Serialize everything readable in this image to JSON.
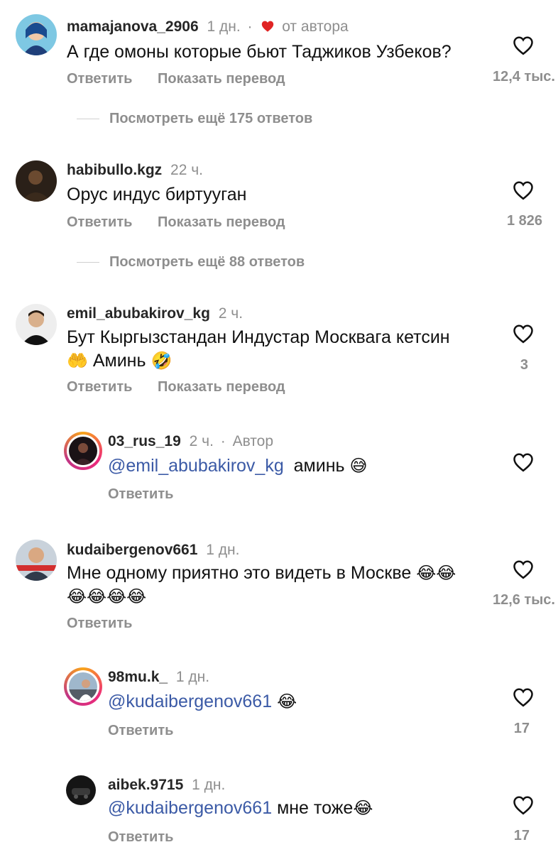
{
  "comments": [
    {
      "username": "mamajanova_2906",
      "time": "1 дн.",
      "author_like_label": "от автора",
      "text": "А где омоны которые бьют Таджиков Узбеков?",
      "reply": "Ответить",
      "translate": "Показать перевод",
      "likes": "12,4 тыс.",
      "view_more": "Посмотреть ещё 175 ответов"
    },
    {
      "username": "habibullo.kgz",
      "time": "22 ч.",
      "text": "Орус индус биртууган",
      "reply": "Ответить",
      "translate": "Показать перевод",
      "likes": "1 826",
      "view_more": "Посмотреть ещё 88 ответов"
    },
    {
      "username": "emil_abubakirov_kg",
      "time": "2 ч.",
      "text_line1": "Бут Кыргызстандан Индустар Москвага кетсин",
      "text_line2": "Аминь",
      "reply": "Ответить",
      "translate": "Показать перевод",
      "likes": "3"
    },
    {
      "username": "03_rus_19",
      "time": "2 ч.",
      "author_label": "Автор",
      "mention": "@emil_abubakirov_kg",
      "text": "аминь",
      "reply": "Ответить"
    },
    {
      "username": "kudaibergenov661",
      "time": "1 дн.",
      "text_line1": "Мне одному приятно это видеть в Москве",
      "reply": "Ответить",
      "likes": "12,6 тыс."
    },
    {
      "username": "98mu.k_",
      "time": "1 дн.",
      "mention": "@kudaibergenov661",
      "reply": "Ответить",
      "likes": "17"
    },
    {
      "username": "aibek.9715",
      "time": "1 дн.",
      "mention": "@kudaibergenov661",
      "text": "мне тоже",
      "reply": "Ответить",
      "likes": "17"
    }
  ],
  "icons": {
    "like": "heart-outline-icon",
    "author_like": "heart-filled-icon"
  },
  "colors": {
    "mention": "#3b5aa6",
    "author_heart": "#e02424",
    "muted": "#8e8e8e"
  }
}
